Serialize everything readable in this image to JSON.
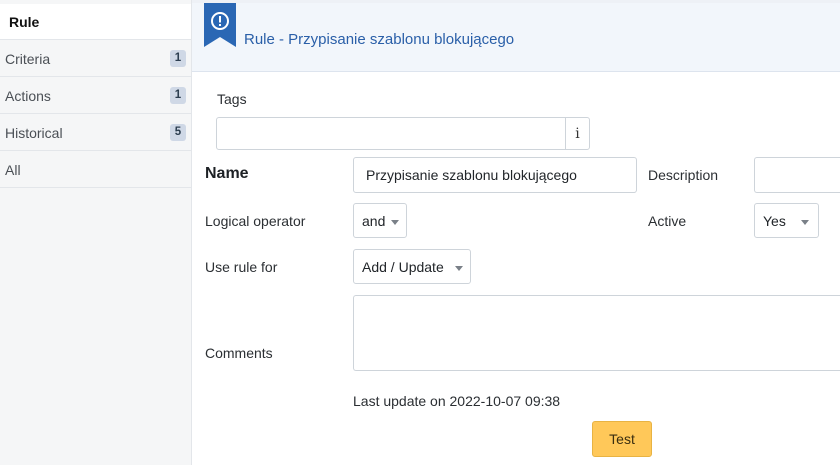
{
  "sidebar": {
    "items": [
      {
        "label": "Rule",
        "badge": ""
      },
      {
        "label": "Criteria",
        "badge": "1"
      },
      {
        "label": "Actions",
        "badge": "1"
      },
      {
        "label": "Historical",
        "badge": "5"
      },
      {
        "label": "All",
        "badge": ""
      }
    ]
  },
  "header": {
    "title": "Rule - Przypisanie szablonu blokującego",
    "icon": "exclamation-circle-icon",
    "ribbon_color": "#2a67b4"
  },
  "form": {
    "tags_label": "Tags",
    "tags_value": "",
    "tags_info_glyph": "i",
    "name_label": "Name",
    "name_value": "Przypisanie szablonu blokującego",
    "description_label": "Description",
    "description_value": "",
    "logical_operator_label": "Logical operator",
    "logical_operator_value": "and",
    "active_label": "Active",
    "active_value": "Yes",
    "use_rule_for_label": "Use rule for",
    "use_rule_for_value": "Add / Update",
    "comments_label": "Comments",
    "comments_value": "",
    "last_update": "Last update on 2022-10-07 09:38",
    "test_button": "Test"
  },
  "colors": {
    "accent": "#2a5fa8",
    "test_button": "#ffc859"
  }
}
